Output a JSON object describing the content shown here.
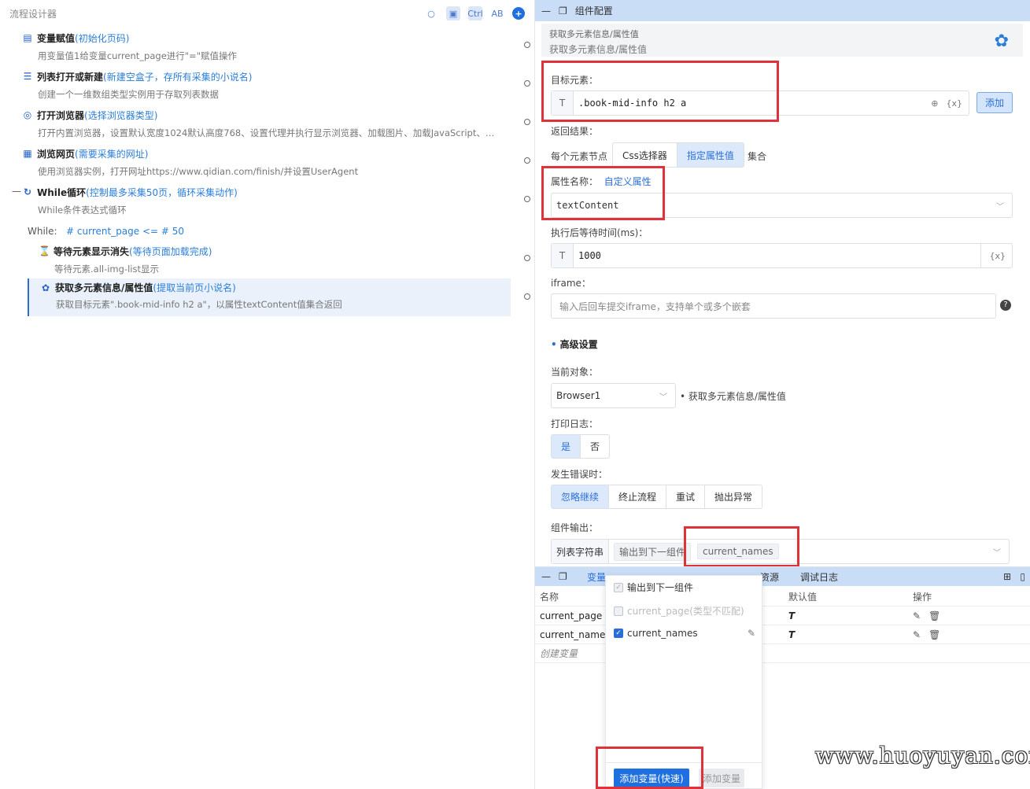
{
  "left": {
    "title": "流程设计器",
    "tools": [
      "Ctrl",
      "AB"
    ],
    "steps": [
      {
        "title": "变量赋值",
        "note": "(初始化页码)",
        "desc": "用变量值1给变量current_page进行\"=\"赋值操作"
      },
      {
        "title": "列表打开或新建",
        "note": "(新建空盒子，存所有采集的小说名)",
        "desc": "创建一个一维数组类型实例用于存取列表数据"
      },
      {
        "title": "打开浏览器",
        "note": "(选择浏览器类型)",
        "desc": "打开内置浏览器，设置默认宽度1024默认高度768、设置代理并执行显示浏览器、加载图片、加载JavaScript、…"
      },
      {
        "title": "浏览网页",
        "note": "(需要采集的网址)",
        "desc": "使用浏览器实例，打开网址https://www.qidian.com/finish/并设置UserAgent"
      },
      {
        "title": "While循环 ",
        "note": "(控制最多采集50页，循环采集动作)",
        "desc": "While条件表达式循环"
      },
      {
        "title": "等待元素显示消失",
        "note": "(等待页面加载完成)",
        "desc": "等待元素.all-img-list显示"
      },
      {
        "title": "获取多元素信息/属性值",
        "note": "(提取当前页小说名)",
        "desc": "获取目标元素\".book-mid-info h2 a\"，以属性textContent值集合返回"
      }
    ],
    "while_label": "While:",
    "while_expr": "# current_page <= # 50"
  },
  "config": {
    "header": "组件配置",
    "card_top": "获取多元素信息/属性值",
    "card_sub": "获取多元素信息/属性值",
    "target_label": "目标元素：",
    "target_value": ".book-mid-info h2 a",
    "add_button": "添加",
    "return_label": "返回结果：",
    "each_node": "每个元素节点",
    "return_options": [
      "Css选择器",
      "指定属性值"
    ],
    "set_label": "集合",
    "attr_label": "属性名称：",
    "custom_attr": "自定义属性",
    "attr_value": "textContent",
    "wait_label": "执行后等待时间(ms)：",
    "wait_value": "1000",
    "iframe_label": "iframe：",
    "iframe_placeholder": "输入后回车提交iframe，支持单个或多个嵌套",
    "advanced": "高级设置",
    "current_obj_label": "当前对象：",
    "current_obj_value": "Browser1",
    "current_obj_note": "• 获取多元素信息/属性值",
    "log_label": "打印日志：",
    "log_options": [
      "是",
      "否"
    ],
    "error_label": "发生错误时：",
    "error_options": [
      "忽略继续",
      "终止流程",
      "重试",
      "抛出异常"
    ],
    "output_label": "组件输出：",
    "output_type": "列表字符串",
    "output_to_next": "输出到下一组件",
    "output_var": "current_names"
  },
  "bottom": {
    "tabs": [
      "变量",
      "资源",
      "调试日志"
    ],
    "columns": [
      "名称",
      "默认值",
      "操作"
    ],
    "rows": [
      {
        "name": "current_page"
      },
      {
        "name": "current_names"
      }
    ],
    "create": "创建变量",
    "type_glyph": "T"
  },
  "popup": {
    "options": [
      {
        "label": "输出到下一组件",
        "state": "checked-disabled"
      },
      {
        "label": "current_page(类型不匹配)",
        "state": "disabled"
      },
      {
        "label": "current_names",
        "state": "checked"
      }
    ],
    "primary": "添加变量(快速)",
    "secondary": "添加变量"
  },
  "watermark": "www.huoyuyan.com",
  "colors": {
    "accent": "#2b6fd6",
    "highlight": "#e0323a",
    "header": "#c9ddf7"
  }
}
